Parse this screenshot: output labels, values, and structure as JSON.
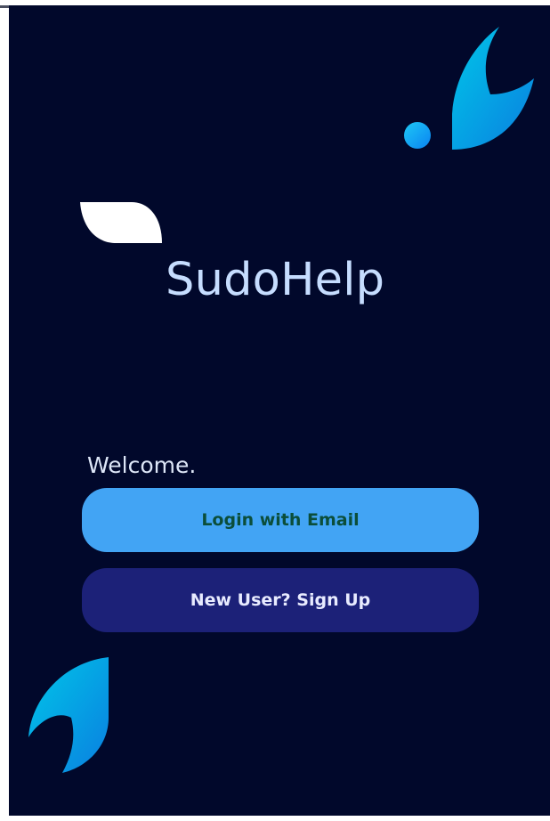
{
  "app": {
    "title": "SudoHelp"
  },
  "welcome": {
    "text": "Welcome."
  },
  "buttons": {
    "login_label": "Login with Email",
    "signup_label": "New User? Sign Up"
  },
  "colors": {
    "background": "#01082b",
    "primary_button": "#42a4f4",
    "secondary_button": "#1c2178",
    "accent_gradient_start": "#00b5e2",
    "accent_gradient_end": "#0b6fe0",
    "title_color": "#c6ddff"
  },
  "decorations": [
    "top-right-leaf-shape",
    "blue-dot",
    "white-leaf-shape",
    "bottom-left-leaf-shape"
  ]
}
